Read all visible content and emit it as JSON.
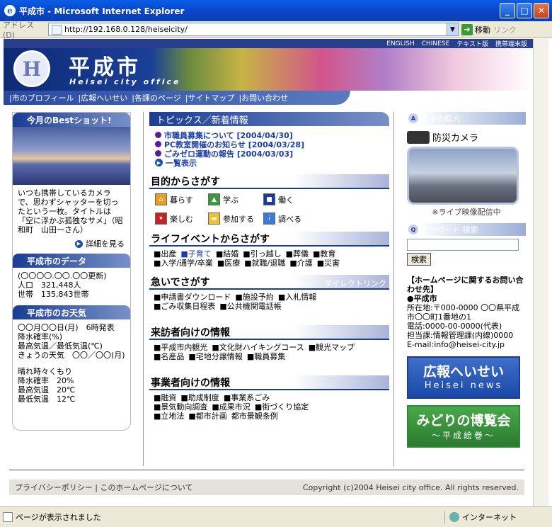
{
  "window": {
    "title": "平成市 - Microsoft Internet Explorer",
    "icon": "ie-logo-icon"
  },
  "addressbar": {
    "label": "アドレス(D)",
    "url": "http://192.168.0.128/heiseicity/",
    "go": "移動",
    "links": "リンク"
  },
  "topnav": [
    "ENGLISH",
    "CHINESE",
    "テキスト版",
    "携帯端末版"
  ],
  "logo": {
    "mark": "H",
    "title": "平成市",
    "subtitle": "Heisei city office"
  },
  "mainnav": [
    "|市のプロフィール",
    "|広報へいせい",
    "|各課のページ",
    "|サイトマップ",
    "|お問い合わせ"
  ],
  "bestshot": {
    "heading": "今月のBestショット!",
    "text": "いつも携帯しているカメラで、思わずシャッターを切ったという一枚。タイトルは「空に浮かぶ孤独なサメ」（昭和町　山田一さん）",
    "more": "詳細を見る"
  },
  "citydata": {
    "heading": "平成市のデータ",
    "updated": "(〇〇〇〇.〇〇.〇〇更新)",
    "population": "人口　321,448人",
    "households": "世帯　135,843世帯"
  },
  "weather": {
    "heading": "平成市のお天気",
    "line1": "〇〇月〇〇日(月)　6時発表",
    "line2": "降水確率(%)",
    "line3": "最高気温／最低気温(℃)",
    "line4": "きょうの天気　〇〇／〇〇(月)",
    "line5": "晴れ時々くもり",
    "line6": "降水確率　20%",
    "line7": "最高気温　20℃",
    "line8": "最低気温　12℃"
  },
  "topics": {
    "heading": "トピックス／新着情報",
    "items": [
      "市職員募集について [2004/04/30]",
      "PC教室開催のお知らせ [2004/03/28]",
      "ごみゼロ運動の報告 [2004/03/03]"
    ],
    "list_link": "一覧表示"
  },
  "purpose": {
    "heading": "目的からさがす",
    "items": [
      "暮らす",
      "学ぶ",
      "働く",
      "楽しむ",
      "参加する",
      "調べる"
    ]
  },
  "lifeevent": {
    "heading": "ライフイベントからさがす",
    "items": [
      "■出産",
      "■子育て",
      "■結婚",
      "■引っ越し",
      "■葬儀",
      "■教育",
      "■入学/通学/卒業",
      "■医療",
      "■就職/退職",
      "■介護",
      "■災害"
    ]
  },
  "urgent": {
    "heading": "急いでさがす",
    "direct": "ダイレクトリンク",
    "items": [
      "■申請書ダウンロード",
      "■施設予約",
      "■入札情報",
      "■ごみ収集日程表",
      "■公共機関電話帳"
    ]
  },
  "visitors": {
    "heading": "来訪者向けの情報",
    "items": [
      "■平成市内観光",
      "■文化財ハイキングコース",
      "■観光マップ",
      "■名産品",
      "■宅地分譲情報",
      "■職員募集"
    ]
  },
  "business": {
    "heading": "事業者向けの情報",
    "items": [
      "■融資",
      "■助成制度",
      "■事業系ごみ",
      "■景気動向調査",
      "■成果市況",
      "■街づくり協定",
      "■立地法",
      "■都市計画",
      "都市景観条例"
    ]
  },
  "rightcol": {
    "fontsize": "文字の拡大",
    "camera": "防災カメラ",
    "camera_caption": "※ライブ映像配信中",
    "search_label": "キーワード 検索",
    "search_button": "検索",
    "contact_title": "【ホームページに関するお問い合わせ先】",
    "contact_org": "●平成市",
    "contact_addr": "所在地:〒000-0000 〇〇県平成市〇〇町1番地の1",
    "contact_tel": "電話:0000-00-0000(代表)",
    "contact_dept": "担当課:情報管理課(内線)0000",
    "contact_email": "E-mail:info@heisei-city.jp",
    "banner1_a": "広報へいせい",
    "banner1_b": "Heisei news",
    "banner2_a": "みどりの博覧会",
    "banner2_b": "～平成絵巻～"
  },
  "footer": {
    "left": "プライバシーポリシー | このホームページについて",
    "right": "Copyright (c)2004 Heisei city office. All rights reserved."
  },
  "statusbar": {
    "text": "ページが表示されました",
    "zone": "インターネット"
  }
}
